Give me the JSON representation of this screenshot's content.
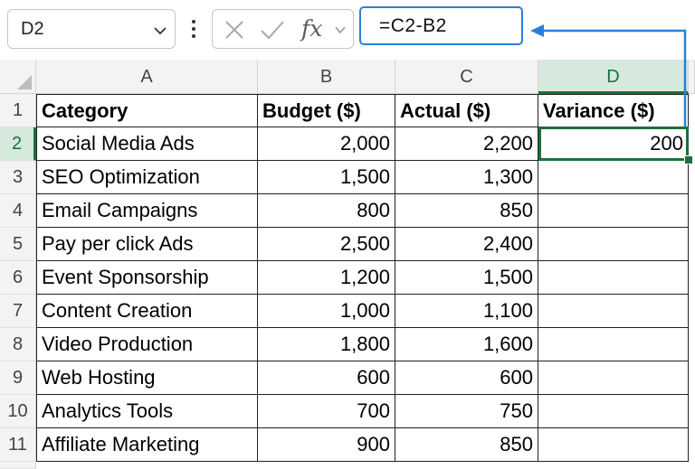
{
  "name_box": {
    "value": "D2",
    "chevron_icon": "chevron-down-icon"
  },
  "formula_bar": {
    "cancel_icon": "cancel-x-icon",
    "enter_icon": "checkmark-icon",
    "fx_label": "fx",
    "formula": "=C2-B2"
  },
  "columns": [
    "A",
    "B",
    "C",
    "D"
  ],
  "selected_column": "D",
  "selected_row": "2",
  "rows": [
    {
      "num": "1",
      "cells": [
        "Category",
        "Budget ($)",
        "Actual ($)",
        "Variance ($)"
      ]
    },
    {
      "num": "2",
      "cells": [
        "Social Media Ads",
        "2,000",
        "2,200",
        "200"
      ]
    },
    {
      "num": "3",
      "cells": [
        "SEO Optimization",
        "1,500",
        "1,300",
        ""
      ]
    },
    {
      "num": "4",
      "cells": [
        "Email Campaigns",
        "800",
        "850",
        ""
      ]
    },
    {
      "num": "5",
      "cells": [
        "Pay per click Ads",
        "2,500",
        "2,400",
        ""
      ]
    },
    {
      "num": "6",
      "cells": [
        "Event Sponsorship",
        "1,200",
        "1,500",
        ""
      ]
    },
    {
      "num": "7",
      "cells": [
        "Content Creation",
        "1,000",
        "1,100",
        ""
      ]
    },
    {
      "num": "8",
      "cells": [
        "Video Production",
        "1,800",
        "1,600",
        ""
      ]
    },
    {
      "num": "9",
      "cells": [
        "Web Hosting",
        "600",
        "600",
        ""
      ]
    },
    {
      "num": "10",
      "cells": [
        "Analytics Tools",
        "700",
        "750",
        ""
      ]
    },
    {
      "num": "11",
      "cells": [
        "Affiliate Marketing",
        "900",
        "850",
        ""
      ]
    }
  ],
  "colors": {
    "accent_green": "#1e6e3e",
    "formula_highlight_blue": "#2b7fd9",
    "header_bg": "#f3f3f3"
  }
}
